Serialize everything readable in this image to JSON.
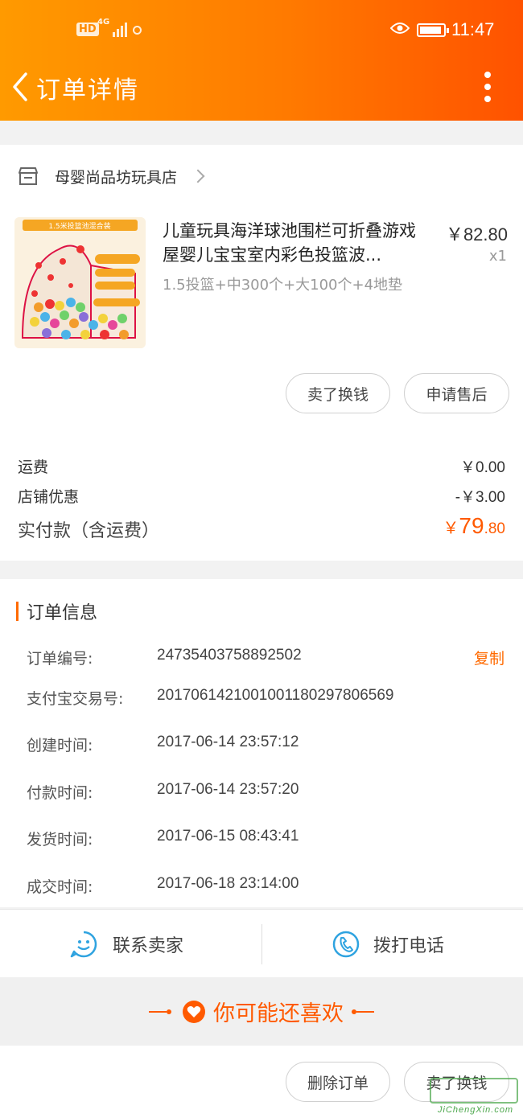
{
  "status_bar": {
    "network": "4G",
    "hd": "HD",
    "time": "11:47"
  },
  "nav": {
    "title": "订单详情"
  },
  "shop": {
    "name": "母婴尚品坊玩具店"
  },
  "product": {
    "title": "儿童玩具海洋球池围栏可折叠游戏屋婴儿宝宝室内彩色投篮波...",
    "price": "￥82.80",
    "qty": "x1",
    "spec": "1.5投篮+中300个+大100个+4地垫",
    "thumb_text": "1.5米投篮池混合装"
  },
  "buttons": {
    "sell": "卖了换钱",
    "after_sale": "申请售后",
    "delete": "删除订单",
    "sell_again": "卖了换钱"
  },
  "fees": [
    {
      "label": "运费",
      "value": "￥0.00"
    },
    {
      "label": "店铺优惠",
      "value": "-￥3.00"
    }
  ],
  "paid": {
    "label": "实付款（含运费）",
    "currency": "￥",
    "int": "79",
    "dec": ".80"
  },
  "order_info": {
    "heading": "订单信息",
    "copy_label": "复制",
    "rows": [
      {
        "label": "订单编号:",
        "value": "24735403758892502"
      },
      {
        "label": "支付宝交易号:",
        "value": "2017061421001001180297806569"
      },
      {
        "label": "创建时间:",
        "value": "2017-06-14 23:57:12"
      },
      {
        "label": "付款时间:",
        "value": "2017-06-14 23:57:20"
      },
      {
        "label": "发货时间:",
        "value": "2017-06-15 08:43:41"
      },
      {
        "label": "成交时间:",
        "value": "2017-06-18 23:14:00"
      }
    ]
  },
  "contact": {
    "seller": "联系卖家",
    "call": "拨打电话"
  },
  "recommend": {
    "title": "你可能还喜欢"
  },
  "watermark": {
    "url": "JiChengXin.com"
  },
  "colors": {
    "accent": "#ff6a00",
    "header_start": "#ff9a00",
    "header_end": "#ff5200"
  }
}
